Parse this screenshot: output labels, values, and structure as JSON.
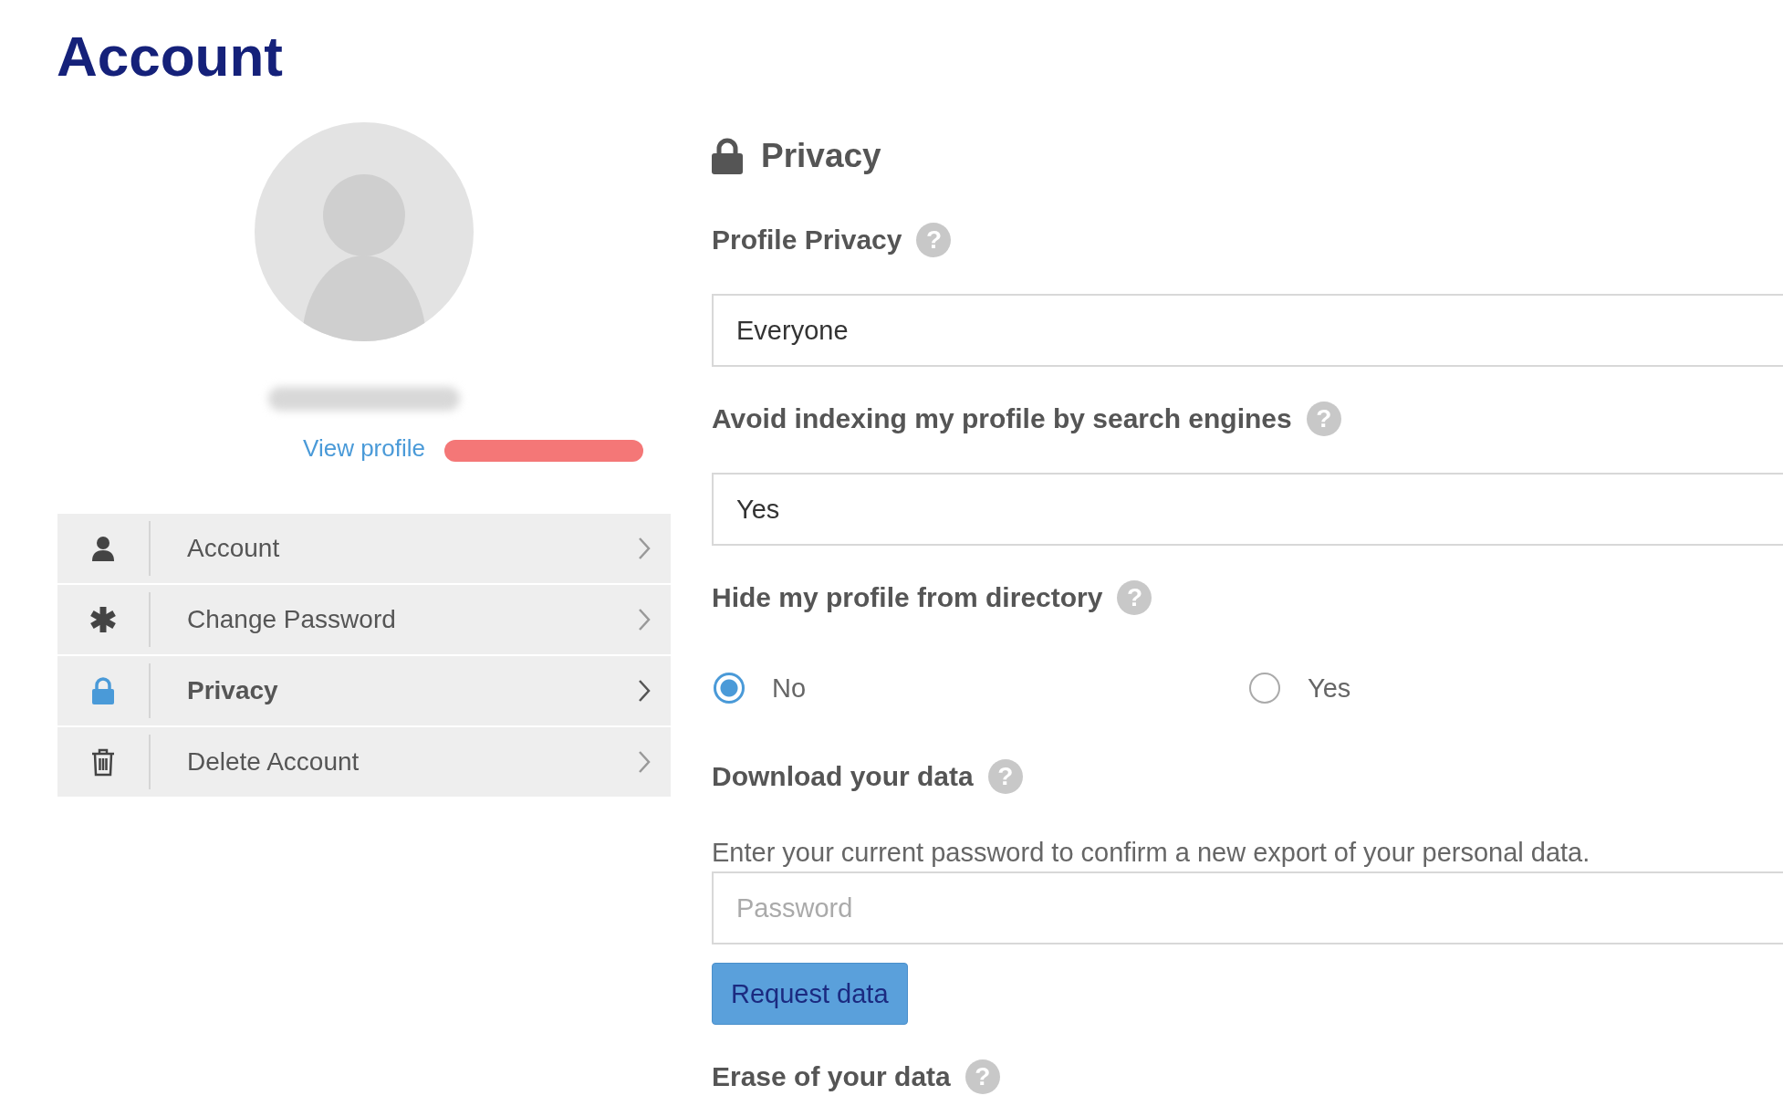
{
  "page": {
    "title": "Account"
  },
  "profile": {
    "link": "View profile"
  },
  "menu": [
    {
      "label": "Account",
      "kind": "user",
      "selected": false
    },
    {
      "label": "Change Password",
      "kind": "asterisk",
      "selected": false
    },
    {
      "label": "Privacy",
      "kind": "lock",
      "selected": true
    },
    {
      "label": "Delete Account",
      "kind": "trash",
      "selected": false
    }
  ],
  "section": {
    "title": "Privacy"
  },
  "settings": [
    {
      "kind": "select",
      "label": "Profile Privacy",
      "help": "?",
      "value": "Everyone"
    },
    {
      "kind": "select",
      "label": "Avoid indexing my profile by search engines",
      "help": "?",
      "value": "Yes"
    },
    {
      "kind": "radio",
      "label": "Hide my profile from directory",
      "help": "?",
      "options": [
        {
          "label": "No",
          "selected": true
        },
        {
          "label": "Yes",
          "selected": false
        }
      ]
    },
    {
      "kind": "download",
      "label": "Download your data",
      "help": "?",
      "description": "Enter your current password to confirm a new export of your personal data.",
      "placeholder": "Password",
      "button": "Request data"
    },
    {
      "kind": "heading",
      "label": "Erase of your data",
      "help": "?"
    }
  ]
}
